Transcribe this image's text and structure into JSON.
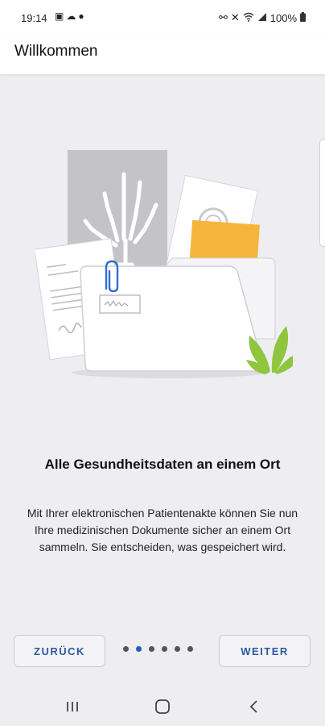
{
  "status_bar": {
    "time": "19:14",
    "battery": "100%",
    "left_icons": [
      "gallery-icon",
      "cloud-icon",
      "location-icon"
    ],
    "right_icons": [
      "link-icon",
      "mute-icon",
      "wifi-icon",
      "signal-icon",
      "battery-icon"
    ]
  },
  "app_bar": {
    "title": "Willkommen"
  },
  "onboarding": {
    "headline": "Alle Gesundheitsdaten an einem Ort",
    "body": "Mit Ihrer elektronischen Patientenakte können Sie nun Ihre medizinischen Dokumente sicher an einem Ort sammeln. Sie entscheiden, was gespeichert wird.",
    "illustration_icon": "documents-folder-illustration"
  },
  "navigation": {
    "back_label": "ZURÜCK",
    "next_label": "WEITER",
    "page_count": 6,
    "current_page": 2
  },
  "colors": {
    "accent": "#1f5fbf",
    "button_text": "#2c5aa0",
    "background": "#eeeef2",
    "folder_yellow": "#f6b53a",
    "plant_green": "#8fc63d"
  },
  "system_nav": [
    "recents-icon",
    "home-icon",
    "back-icon"
  ]
}
